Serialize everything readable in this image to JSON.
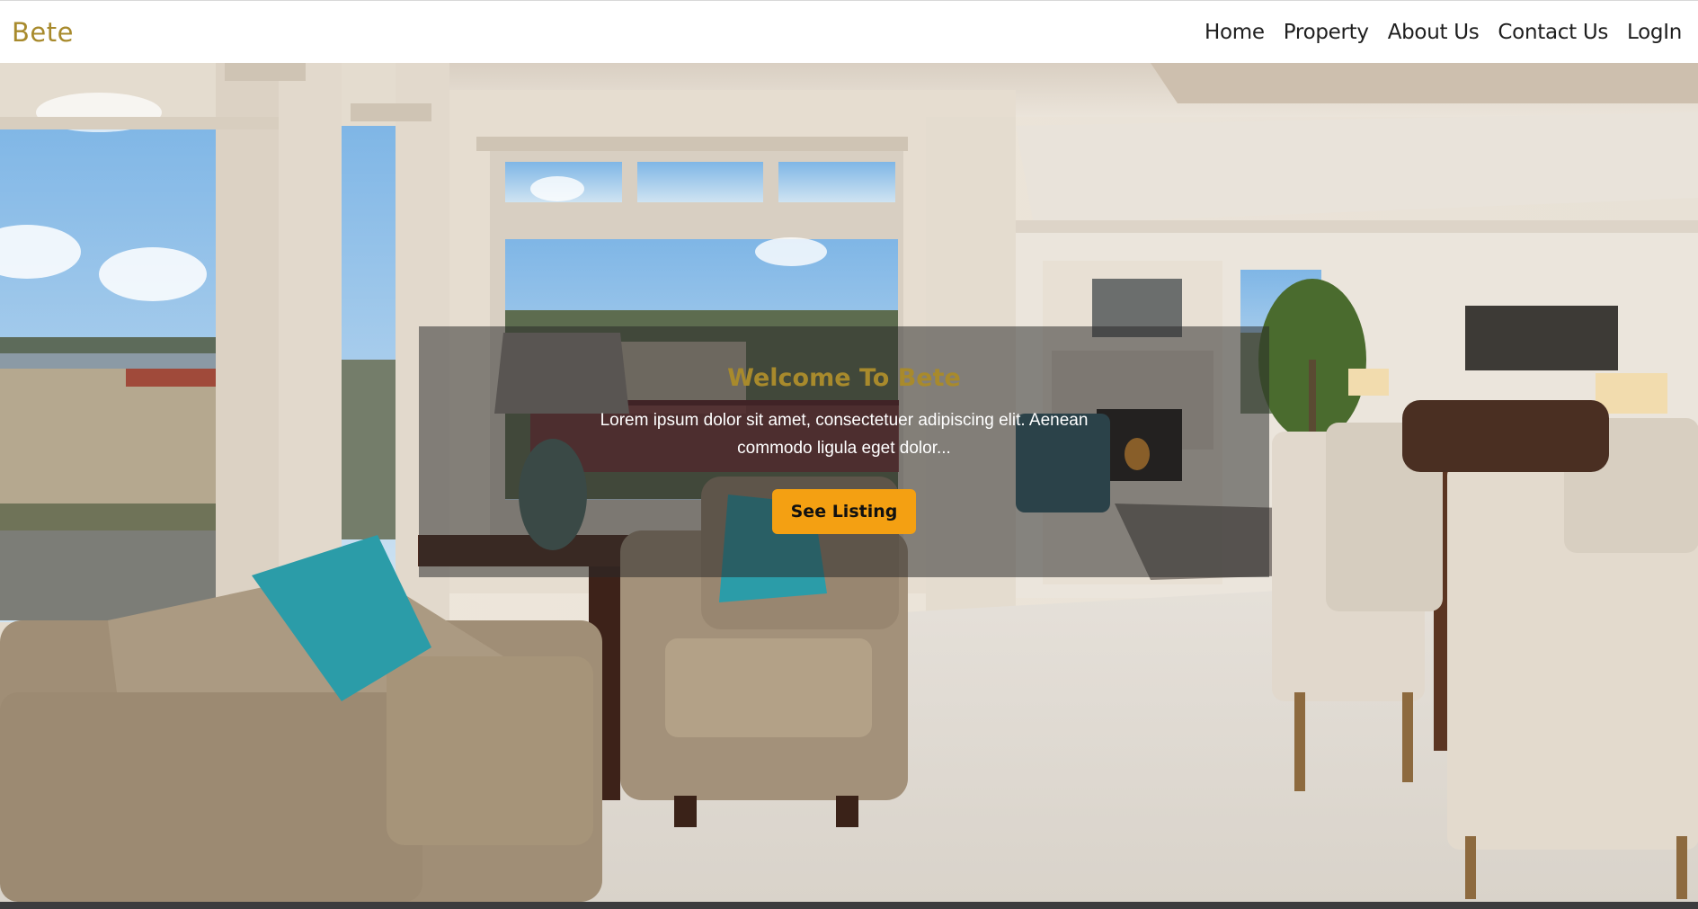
{
  "brand": {
    "name": "Bete"
  },
  "nav": {
    "items": [
      {
        "label": "Home"
      },
      {
        "label": "Property"
      },
      {
        "label": "About Us"
      },
      {
        "label": "Contact Us"
      },
      {
        "label": "LogIn"
      }
    ]
  },
  "hero": {
    "title": "Welcome To Bete",
    "text": "Lorem ipsum dolor sit amet, consectetuer adipiscing elit. Aenean commodo ligula eget dolor...",
    "cta_label": "See Listing",
    "background_image": "living-room-photo"
  },
  "colors": {
    "brand": "#a88a2c",
    "cta": "#f4a012",
    "nav_bg": "#ffffff",
    "caption_overlay": "rgba(40,40,40,0.52)"
  }
}
